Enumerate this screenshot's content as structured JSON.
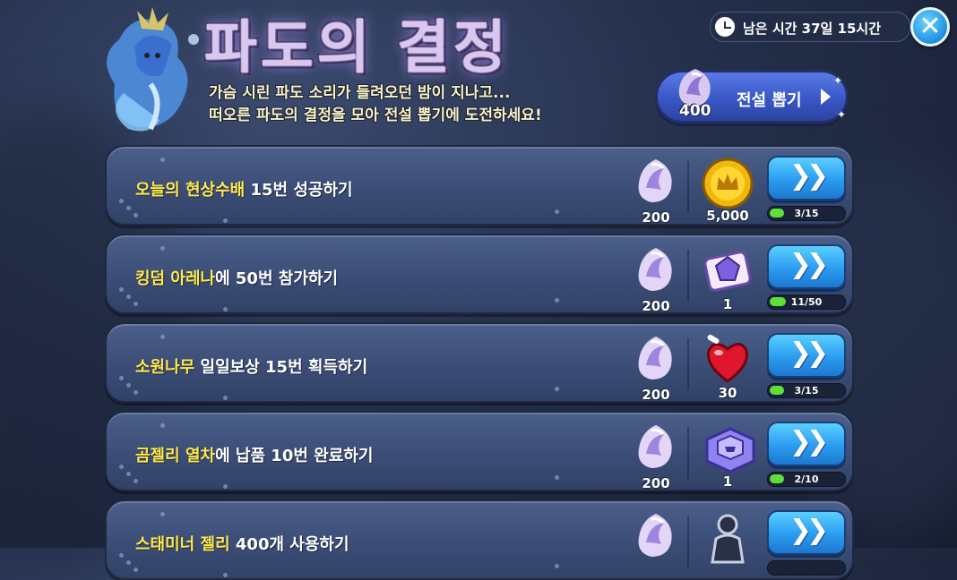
{
  "header": {
    "title": "파도의 결정",
    "subtitle_line1": "가슴 시린 파도 소리가 들려오던 밤이 지나고...",
    "subtitle_line2": "떠오른 파도의 결정을 모아 전설 뽑기에 도전하세요!",
    "timer_text": "남은 시간 37일 15시간",
    "close_icon": "close-icon"
  },
  "gacha": {
    "label": "전설 뽑기",
    "cost": "400",
    "icon": "wave-crystal-icon"
  },
  "missions": [
    {
      "highlight": "오늘의 현상수배",
      "rest": " 15번 성공하기",
      "crystal": "200",
      "reward_icon": "gold-coin-icon",
      "reward_amount": "5,000",
      "progress": "3/15",
      "progress_fraction": 0.2
    },
    {
      "highlight": "킹덤 아레나",
      "rest": "에 50번 참가하기",
      "crystal": "200",
      "reward_icon": "gem-ticket-icon",
      "reward_amount": "1",
      "progress": "11/50",
      "progress_fraction": 0.22
    },
    {
      "highlight": "소원나무",
      "rest": " 일일보상 15번 획득하기",
      "crystal": "200",
      "reward_icon": "heart-jelly-icon",
      "reward_amount": "30",
      "progress": "3/15",
      "progress_fraction": 0.2
    },
    {
      "highlight": "곰젤리 열차",
      "rest": "에 납품 10번 완료하기",
      "crystal": "200",
      "reward_icon": "treasure-box-icon",
      "reward_amount": "1",
      "progress": "2/10",
      "progress_fraction": 0.2
    },
    {
      "highlight": "스태미너 젤리",
      "rest": " 400개 사용하기",
      "crystal": "",
      "reward_icon": "cookie-silhouette-icon",
      "reward_amount": "",
      "progress": "",
      "progress_fraction": 0
    }
  ],
  "colors": {
    "highlight_text": "#ffe94a",
    "button_blue": "#2b9cf0",
    "progress_green": "#5ee03a"
  }
}
